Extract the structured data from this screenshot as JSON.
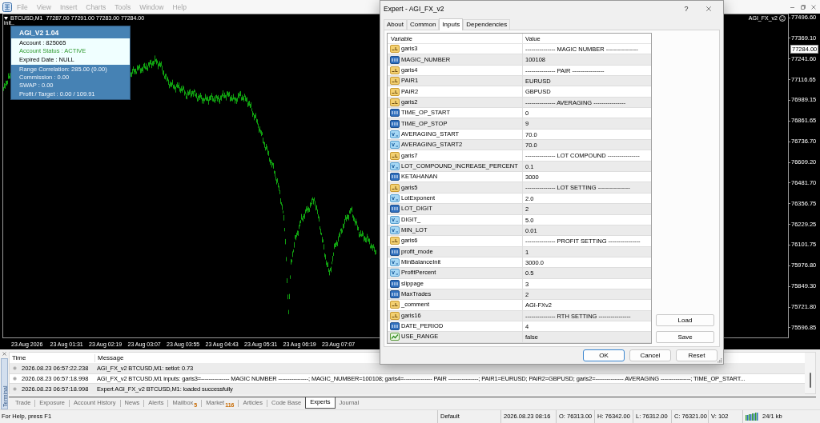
{
  "menu_bar": {
    "items": [
      {
        "label": "File",
        "disabled": true
      },
      {
        "label": "View",
        "disabled": true
      },
      {
        "label": "Insert",
        "disabled": true
      },
      {
        "label": "Charts",
        "disabled": true
      },
      {
        "label": "Tools",
        "disabled": true
      },
      {
        "label": "Window",
        "disabled": true
      },
      {
        "label": "Help",
        "disabled": true
      }
    ]
  },
  "chart": {
    "symbol": "BTCUSD,M1",
    "ohlc": "77287.00 77291.00 77283.00 77284.00",
    "status": "init..",
    "expert": "AGI_FX_v2",
    "price_axis": {
      "labels": [
        "77496.60",
        "77369.10",
        "77241.60",
        "77116.65",
        "76989.15",
        "76861.65",
        "76736.70",
        "76609.20",
        "76481.70",
        "76356.75",
        "76229.25",
        "76101.75",
        "75976.80",
        "75849.30",
        "75721.80",
        "75596.85"
      ],
      "current": "77284.00"
    },
    "time_axis": {
      "labels": [
        "23 Aug 2026",
        "23 Aug 01:31",
        "23 Aug 02:19",
        "23 Aug 03:07",
        "23 Aug 03:55",
        "23 Aug 04:43",
        "23 Aug 05:31",
        "23 Aug 06:19",
        "23 Aug 07:07"
      ]
    }
  },
  "info_panel": {
    "title": "AGI_V2 1.04",
    "account_lines": [
      {
        "kind": "plain",
        "text": "Account : 825065"
      },
      {
        "kind": "status",
        "text": "Account Status : ACTIVE"
      },
      {
        "kind": "plain",
        "text": "Expired Date : NULL"
      }
    ],
    "stats": [
      "Range Correlation: 285.00 (0.00)",
      "Commission : 0.00",
      "SWAP : 0.00",
      "Profit / Target : 0.00 / 109.91"
    ]
  },
  "dialog": {
    "title": "Expert - AGI_FX_v2",
    "help": "?",
    "tabs": [
      {
        "label": "About",
        "selected": false
      },
      {
        "label": "Common",
        "selected": false
      },
      {
        "label": "Inputs",
        "selected": true
      },
      {
        "label": "Dependencies",
        "selected": false
      }
    ],
    "table": {
      "columns": [
        "Variable",
        "Value"
      ],
      "rows": [
        {
          "kind": "string",
          "variable": "garis3",
          "value": "--------------- MAGIC NUMBER ----------------"
        },
        {
          "kind": "int",
          "variable": "MAGIC_NUMBER",
          "value": "100108"
        },
        {
          "kind": "string",
          "variable": "garis4",
          "value": "--------------- PAIR ----------------"
        },
        {
          "kind": "string",
          "variable": "PAIR1",
          "value": "EURUSD"
        },
        {
          "kind": "string",
          "variable": "PAIR2",
          "value": "GBPUSD"
        },
        {
          "kind": "string",
          "variable": "garis2",
          "value": "--------------- AVERAGING ----------------"
        },
        {
          "kind": "int",
          "variable": "TIME_OP_START",
          "value": "0"
        },
        {
          "kind": "int",
          "variable": "TIME_OP_STOP",
          "value": "9"
        },
        {
          "kind": "double",
          "variable": "AVERAGING_START",
          "value": "70.0"
        },
        {
          "kind": "double",
          "variable": "AVERAGING_START2",
          "value": "70.0"
        },
        {
          "kind": "string",
          "variable": "garis7",
          "value": "--------------- LOT COMPOUND ----------------"
        },
        {
          "kind": "double",
          "variable": "LOT_COMPOUND_INCREASE_PERCENT",
          "value": "0.1"
        },
        {
          "kind": "int",
          "variable": "KETAHANAN",
          "value": "3000"
        },
        {
          "kind": "string",
          "variable": "garis5",
          "value": "--------------- LOT SETTING ----------------"
        },
        {
          "kind": "double",
          "variable": "LotExponent",
          "value": "2.0"
        },
        {
          "kind": "int",
          "variable": "LOT_DIGIT",
          "value": "2"
        },
        {
          "kind": "double",
          "variable": "DIGIT_",
          "value": "5.0"
        },
        {
          "kind": "double",
          "variable": "MIN_LOT",
          "value": "0.01"
        },
        {
          "kind": "string",
          "variable": "garis6",
          "value": "--------------- PROFIT SETTING ----------------"
        },
        {
          "kind": "int",
          "variable": "profit_mode",
          "value": "1"
        },
        {
          "kind": "double",
          "variable": "MinBalanceInit",
          "value": "3000.0"
        },
        {
          "kind": "double",
          "variable": "ProfitPercent",
          "value": "0.5"
        },
        {
          "kind": "int",
          "variable": "slippage",
          "value": "3"
        },
        {
          "kind": "int",
          "variable": "MaxTrades",
          "value": "2"
        },
        {
          "kind": "string",
          "variable": "_comment",
          "value": "AGI-FXv2"
        },
        {
          "kind": "string",
          "variable": "garis16",
          "value": "--------------- RTH SETTING ----------------"
        },
        {
          "kind": "int",
          "variable": "DATE_PERIOD",
          "value": "4"
        },
        {
          "kind": "bool",
          "variable": "USE_RANGE",
          "value": "false"
        }
      ]
    },
    "side_buttons": [
      "Load",
      "Save"
    ],
    "buttons": [
      {
        "label": "OK",
        "default": true
      },
      {
        "label": "Cancel",
        "default": false
      },
      {
        "label": "Reset",
        "default": false
      }
    ]
  },
  "terminal": {
    "side_tab": "Terminal",
    "columns": [
      "Time",
      "Message"
    ],
    "rows": [
      {
        "time": "2026.08.23 06:57:22.238",
        "message": "AGI_FX_v2 BTCUSD,M1: setlot: 0.73"
      },
      {
        "time": "2026.08.23 06:57:18.998",
        "message": "AGI_FX_v2 BTCUSD,M1 inputs: garis3=--------------- MAGIC NUMBER ----------------; MAGIC_NUMBER=100108; garis4=--------------- PAIR ----------------; PAIR1=EURUSD; PAIR2=GBPUSD; garis2=--------------- AVERAGING ----------------; TIME_OP_START..."
      },
      {
        "time": "2026.08.23 06:57:18.998",
        "message": "Expert AGI_FX_v2 BTCUSD,M1: loaded successfully"
      }
    ],
    "tabs": [
      {
        "label": "Trade",
        "selected": false
      },
      {
        "label": "Exposure",
        "selected": false
      },
      {
        "label": "Account History",
        "selected": false
      },
      {
        "label": "News",
        "selected": false
      },
      {
        "label": "Alerts",
        "selected": false
      },
      {
        "label": "Mailbox",
        "badge": "5",
        "selected": false
      },
      {
        "label": "Market",
        "badge": "116",
        "selected": false
      },
      {
        "label": "Articles",
        "selected": false
      },
      {
        "label": "Code Base",
        "selected": false
      },
      {
        "label": "Experts",
        "selected": true
      },
      {
        "label": "Journal",
        "selected": false
      }
    ]
  },
  "status_bar": {
    "help": "For Help, press F1",
    "profile": "Default",
    "datetime": "2026.08.23 08:16",
    "open": "O: 76313.00",
    "high": "H: 76342.00",
    "low": "L: 76312.00",
    "close": "C: 76321.00",
    "volume": "V: 102",
    "traffic": "24/1 kb"
  }
}
